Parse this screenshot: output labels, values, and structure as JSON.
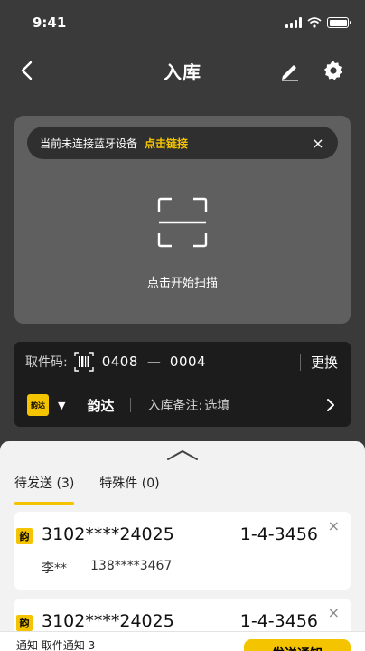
{
  "status_bar": {
    "time": "9:41"
  },
  "nav": {
    "title": "入库"
  },
  "bluetooth_banner": {
    "message": "当前未连接蓝牙设备",
    "link": "点击链接",
    "close": "×"
  },
  "scan": {
    "label": "点击开始扫描"
  },
  "pickup": {
    "label": "取件码:",
    "code_prefix": "0408",
    "dash": "—",
    "code_suffix": "0004",
    "change": "更换"
  },
  "courier": {
    "logo_text": "韵达",
    "caret": "▼",
    "name": "韵达",
    "remark_label": "入库备注:",
    "remark_value": "选填"
  },
  "tabs": [
    {
      "label": "待发送 (3)",
      "active": true
    },
    {
      "label": "特殊件 (0)",
      "active": false
    }
  ],
  "cards": [
    {
      "badge": "韵",
      "tracking": "3102****24025",
      "code": "1-4-3456",
      "close": "×",
      "name": "李**",
      "phone": "138****3467"
    },
    {
      "badge": "韵",
      "tracking": "3102****24025",
      "code": "1-4-3456",
      "close": "×",
      "name": "",
      "phone": ""
    }
  ],
  "bottom_bar": {
    "text": "通知  取件通知 3",
    "button": "发送通知"
  },
  "colors": {
    "accent": "#f5c400",
    "background": "#3a3a3a",
    "panel": "#5f5f5f"
  }
}
